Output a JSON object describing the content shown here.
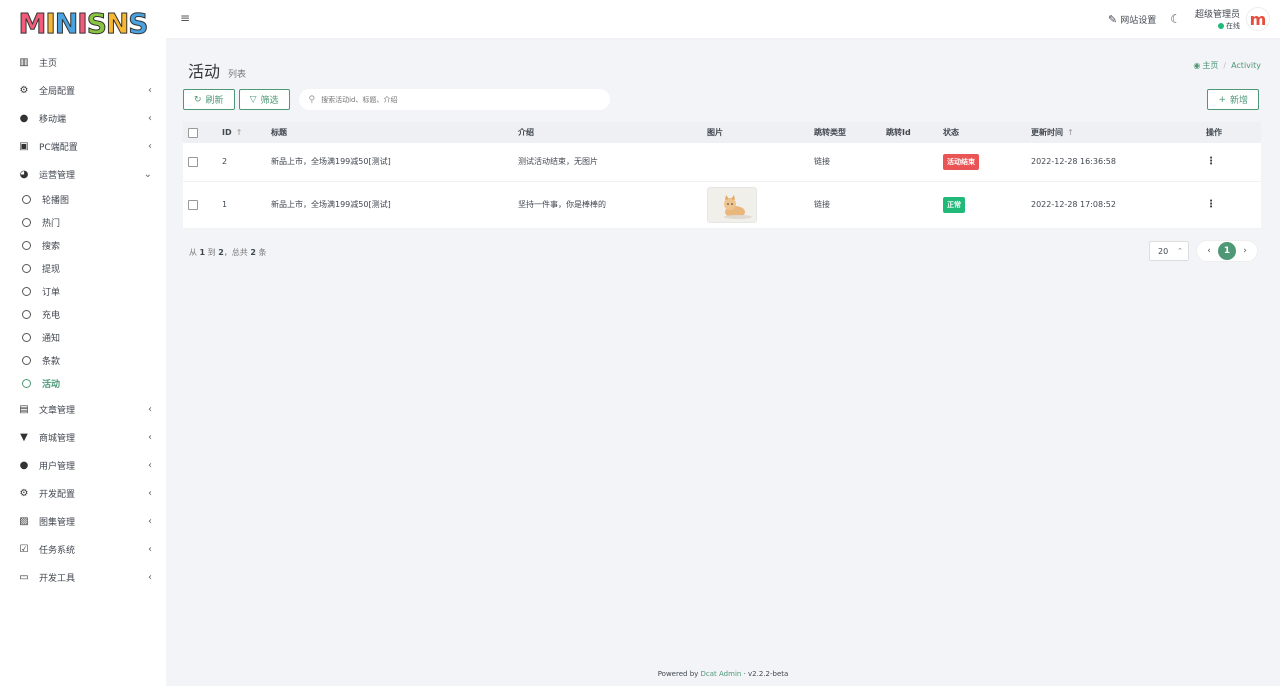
{
  "brand": {
    "logo_text": "MINISNS"
  },
  "sidebar": {
    "items": [
      {
        "label": "主页",
        "icon": "bar-chart-icon",
        "glyph": "▥",
        "chevron": ""
      },
      {
        "label": "全局配置",
        "icon": "gear-icon",
        "glyph": "⚙",
        "chevron": "‹"
      },
      {
        "label": "移动端",
        "icon": "wechat-icon",
        "glyph": "●",
        "chevron": "‹"
      },
      {
        "label": "PC端配置",
        "icon": "desktop-icon",
        "glyph": "▣",
        "chevron": "‹"
      },
      {
        "label": "运营管理",
        "icon": "pie-chart-icon",
        "glyph": "◕",
        "chevron": "⌄"
      }
    ],
    "sub_items": [
      "轮播图",
      "热门",
      "搜索",
      "提现",
      "订单",
      "充电",
      "通知",
      "条款",
      "活动"
    ],
    "items_after": [
      {
        "label": "文章管理",
        "icon": "book-icon",
        "glyph": "▤",
        "chevron": "‹"
      },
      {
        "label": "商城管理",
        "icon": "cart-icon",
        "glyph": "▼",
        "chevron": "‹"
      },
      {
        "label": "用户管理",
        "icon": "users-icon",
        "glyph": "●",
        "chevron": "‹"
      },
      {
        "label": "开发配置",
        "icon": "cog-outline-icon",
        "glyph": "⚙",
        "chevron": "‹"
      },
      {
        "label": "图集管理",
        "icon": "image-icon",
        "glyph": "▨",
        "chevron": "‹"
      },
      {
        "label": "任务系统",
        "icon": "check-square-icon",
        "glyph": "☑",
        "chevron": "‹"
      },
      {
        "label": "开发工具",
        "icon": "keyboard-icon",
        "glyph": "▭",
        "chevron": "‹"
      }
    ]
  },
  "header": {
    "site_settings": "网站设置",
    "user_name": "超级管理员",
    "user_status": "在线",
    "avatar_letter": "m"
  },
  "page": {
    "title": "活动",
    "subtitle": "列表",
    "breadcrumb_home": "主页",
    "breadcrumb_current": "Activity"
  },
  "toolbar": {
    "refresh": "刷新",
    "filter": "筛选",
    "search_placeholder": "搜索活动id、标题、介绍",
    "add": "新增"
  },
  "table": {
    "columns": [
      "ID",
      "标题",
      "介绍",
      "图片",
      "跳转类型",
      "跳转Id",
      "状态",
      "更新时间",
      "操作"
    ],
    "rows": [
      {
        "id": "2",
        "title": "新品上市，全场满199减50[测试]",
        "intro": "测试活动结束，无图片",
        "jump_type": "链接",
        "jump_id": "",
        "status": "活动结束",
        "updated": "2022-12-28 16:36:58"
      },
      {
        "id": "1",
        "title": "新品上市，全场满199减50[测试]",
        "intro": "坚持一件事，你是棒棒的",
        "jump_type": "链接",
        "jump_id": "",
        "status": "正常",
        "updated": "2022-12-28 17:08:52"
      }
    ]
  },
  "pagination": {
    "summary_prefix": "从",
    "from": "1",
    "to_word": "到",
    "to": "2",
    "total_word": "，总共",
    "total": "2",
    "unit": "条",
    "per_page": "20",
    "current": "1"
  },
  "footer": {
    "prefix": "Powered by",
    "link": "Dcat Admin",
    "sep": "·",
    "version": "v2.2.2-beta"
  },
  "colors": {
    "accent": "#4e9876",
    "danger": "#ea5455",
    "success": "#21b978"
  }
}
